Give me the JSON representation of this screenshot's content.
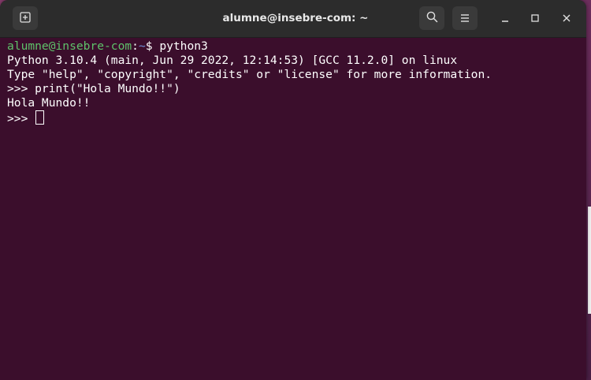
{
  "window": {
    "title": "alumne@insebre-com: ~"
  },
  "terminal": {
    "prompt": {
      "user_host": "alumne@insebre-com",
      "separator": ":",
      "path": "~",
      "symbol": "$ ",
      "command": "python3"
    },
    "lines": [
      "Python 3.10.4 (main, Jun 29 2022, 12:14:53) [GCC 11.2.0] on linux",
      "Type \"help\", \"copyright\", \"credits\" or \"license\" for more information.",
      ">>> print(\"Hola Mundo!!\")",
      "Hola Mundo!!"
    ],
    "repl_prompt": ">>> "
  },
  "icons": {
    "new_tab": "new-tab-icon",
    "search": "search-icon",
    "menu": "hamburger-menu-icon",
    "minimize": "minimize-icon",
    "maximize": "maximize-icon",
    "close": "close-icon"
  },
  "colors": {
    "terminal_bg": "#3b0e2c",
    "titlebar_bg": "#2c2c2c",
    "prompt_user": "#5ec26a",
    "prompt_path": "#6f8fd8",
    "text": "#ffffff"
  }
}
